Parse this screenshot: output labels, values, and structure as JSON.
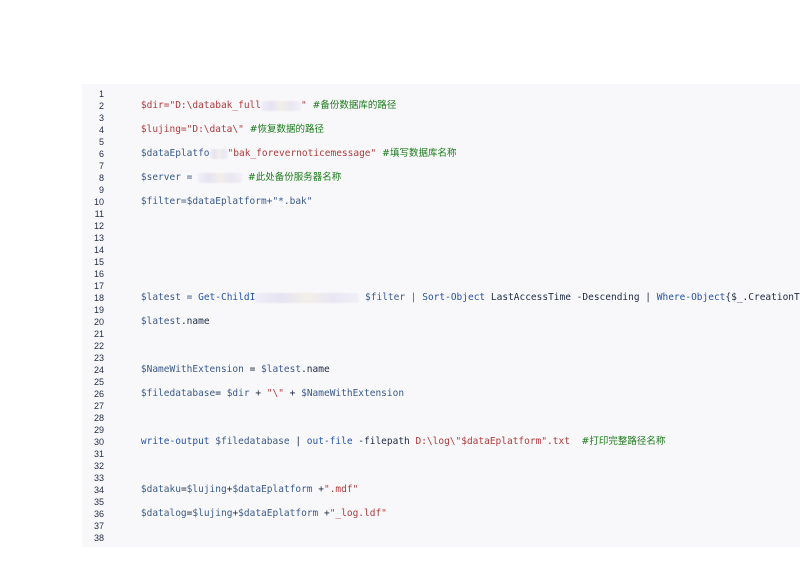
{
  "line_numbers": [
    "1",
    "2",
    "3",
    "4",
    "5",
    "6",
    "7",
    "8",
    "9",
    "10",
    "11",
    "12",
    "13",
    "14",
    "15",
    "16",
    "17",
    "18",
    "19",
    "20",
    "21",
    "22",
    "23",
    "24",
    "25",
    "26",
    "27",
    "28",
    "29",
    "30",
    "31",
    "32",
    "33",
    "34",
    "35",
    "36",
    "37",
    "38"
  ],
  "code": {
    "l1": {
      "a": "$dir=\"D:\\databak_full",
      "b": "\"",
      "c": "#备份数据库的路径"
    },
    "l3": {
      "a": "$lujing=\"D:\\data\\\"",
      "c": "#恢复数据的路径"
    },
    "l5": {
      "a": "$dataEplatfo",
      "b": "\"bak_forevernoticemessage\"",
      "c": "#填写数据库名称"
    },
    "l7": {
      "a": "$server = ",
      "c": "#此处备份服务器名称"
    },
    "l9": {
      "a": "$filter=$dataEplatform+\"*.bak\""
    },
    "l17": {
      "a": "$latest = ",
      "k1": "Get-ChildI",
      "b": "$filter | ",
      "k2": "Sort-Object",
      "c": " LastAccessTime -Descending | ",
      "k3": "Where-Object",
      "d": "{$_.CreationTime -lt (Get-Date).A"
    },
    "l19": {
      "v": "$latest",
      "a": ".name"
    },
    "l23": {
      "v": "$NameWithExtension",
      "a": " = ",
      "v2": "$latest",
      "b": ".name"
    },
    "l25": {
      "v": "$filedatabase",
      "a": "= ",
      "v2": "$dir",
      "b": " + ",
      "s": "\"\\\"",
      "c": " + ",
      "v3": "$NameWithExtension"
    },
    "l29": {
      "k1": "write-output",
      "a": " ",
      "v": "$filedatabase",
      "b": " | ",
      "k2": "out-file",
      "c": " -filepath ",
      "s": "D:\\log\\\"$dataEplatform\".txt",
      "cm": "#打印完整路径名称"
    },
    "l33": {
      "v": "$dataku",
      "a": "=",
      "v2": "$lujing",
      "b": "+",
      "v3": "$dataEplatform",
      "c": " +",
      "s": "\".mdf\""
    },
    "l35": {
      "v": "$datalog",
      "a": "=",
      "v2": "$lujing",
      "b": "+",
      "v3": "$dataEplatform",
      "c": " +",
      "s": "\"_log.ldf\""
    }
  }
}
